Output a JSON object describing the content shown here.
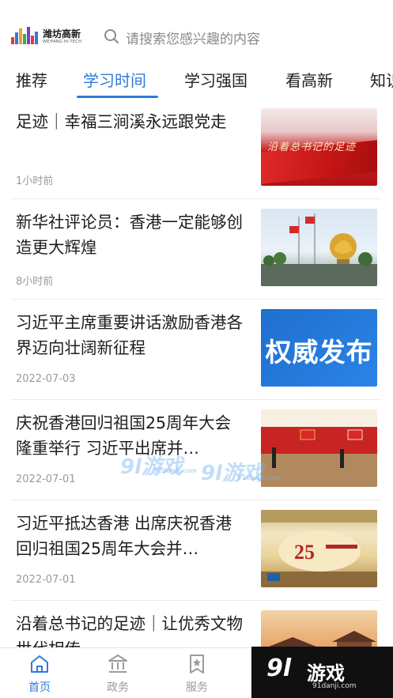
{
  "header": {
    "logo_cn": "潍坊高新",
    "logo_en": "WEIFANG HI-TECH",
    "search_placeholder": "请搜索您感兴趣的内容"
  },
  "tabs": [
    {
      "label": "推荐",
      "active": false
    },
    {
      "label": "学习时间",
      "active": true
    },
    {
      "label": "学习强国",
      "active": false
    },
    {
      "label": "看高新",
      "active": false
    },
    {
      "label": "知识",
      "active": false
    }
  ],
  "feed": [
    {
      "title": "足迹｜幸福三涧溪永远跟党走",
      "time": "1小时前",
      "thumb_text": "沿着总书记的足迹"
    },
    {
      "title": "新华社评论员：香港一定能够创造更大辉煌",
      "time": "8小时前"
    },
    {
      "title": "习近平主席重要讲话激励香港各界迈向壮阔新征程",
      "time": "2022-07-03",
      "thumb_text": "权威发布"
    },
    {
      "title": "庆祝香港回归祖国25周年大会隆重举行 习近平出席并…",
      "time": "2022-07-01"
    },
    {
      "title": "习近平抵达香港 出席庆祝香港回归祖国25周年大会并…",
      "time": "2022-07-01"
    },
    {
      "title": "沿着总书记的足迹｜让优秀文物世代相传",
      "time": ""
    }
  ],
  "watermark": {
    "text": "9l游戏",
    "sub": "91danji.com"
  },
  "bottom_nav": [
    {
      "label": "首页",
      "icon": "home-icon",
      "active": true
    },
    {
      "label": "政务",
      "icon": "government-icon",
      "active": false
    },
    {
      "label": "服务",
      "icon": "service-icon",
      "active": false
    }
  ],
  "brand": {
    "text": "游戏",
    "logo": "9l",
    "sub": "91danji.com"
  },
  "colors": {
    "accent": "#2f7bd9",
    "text": "#1d1d1d",
    "muted": "#9a9a9a"
  }
}
